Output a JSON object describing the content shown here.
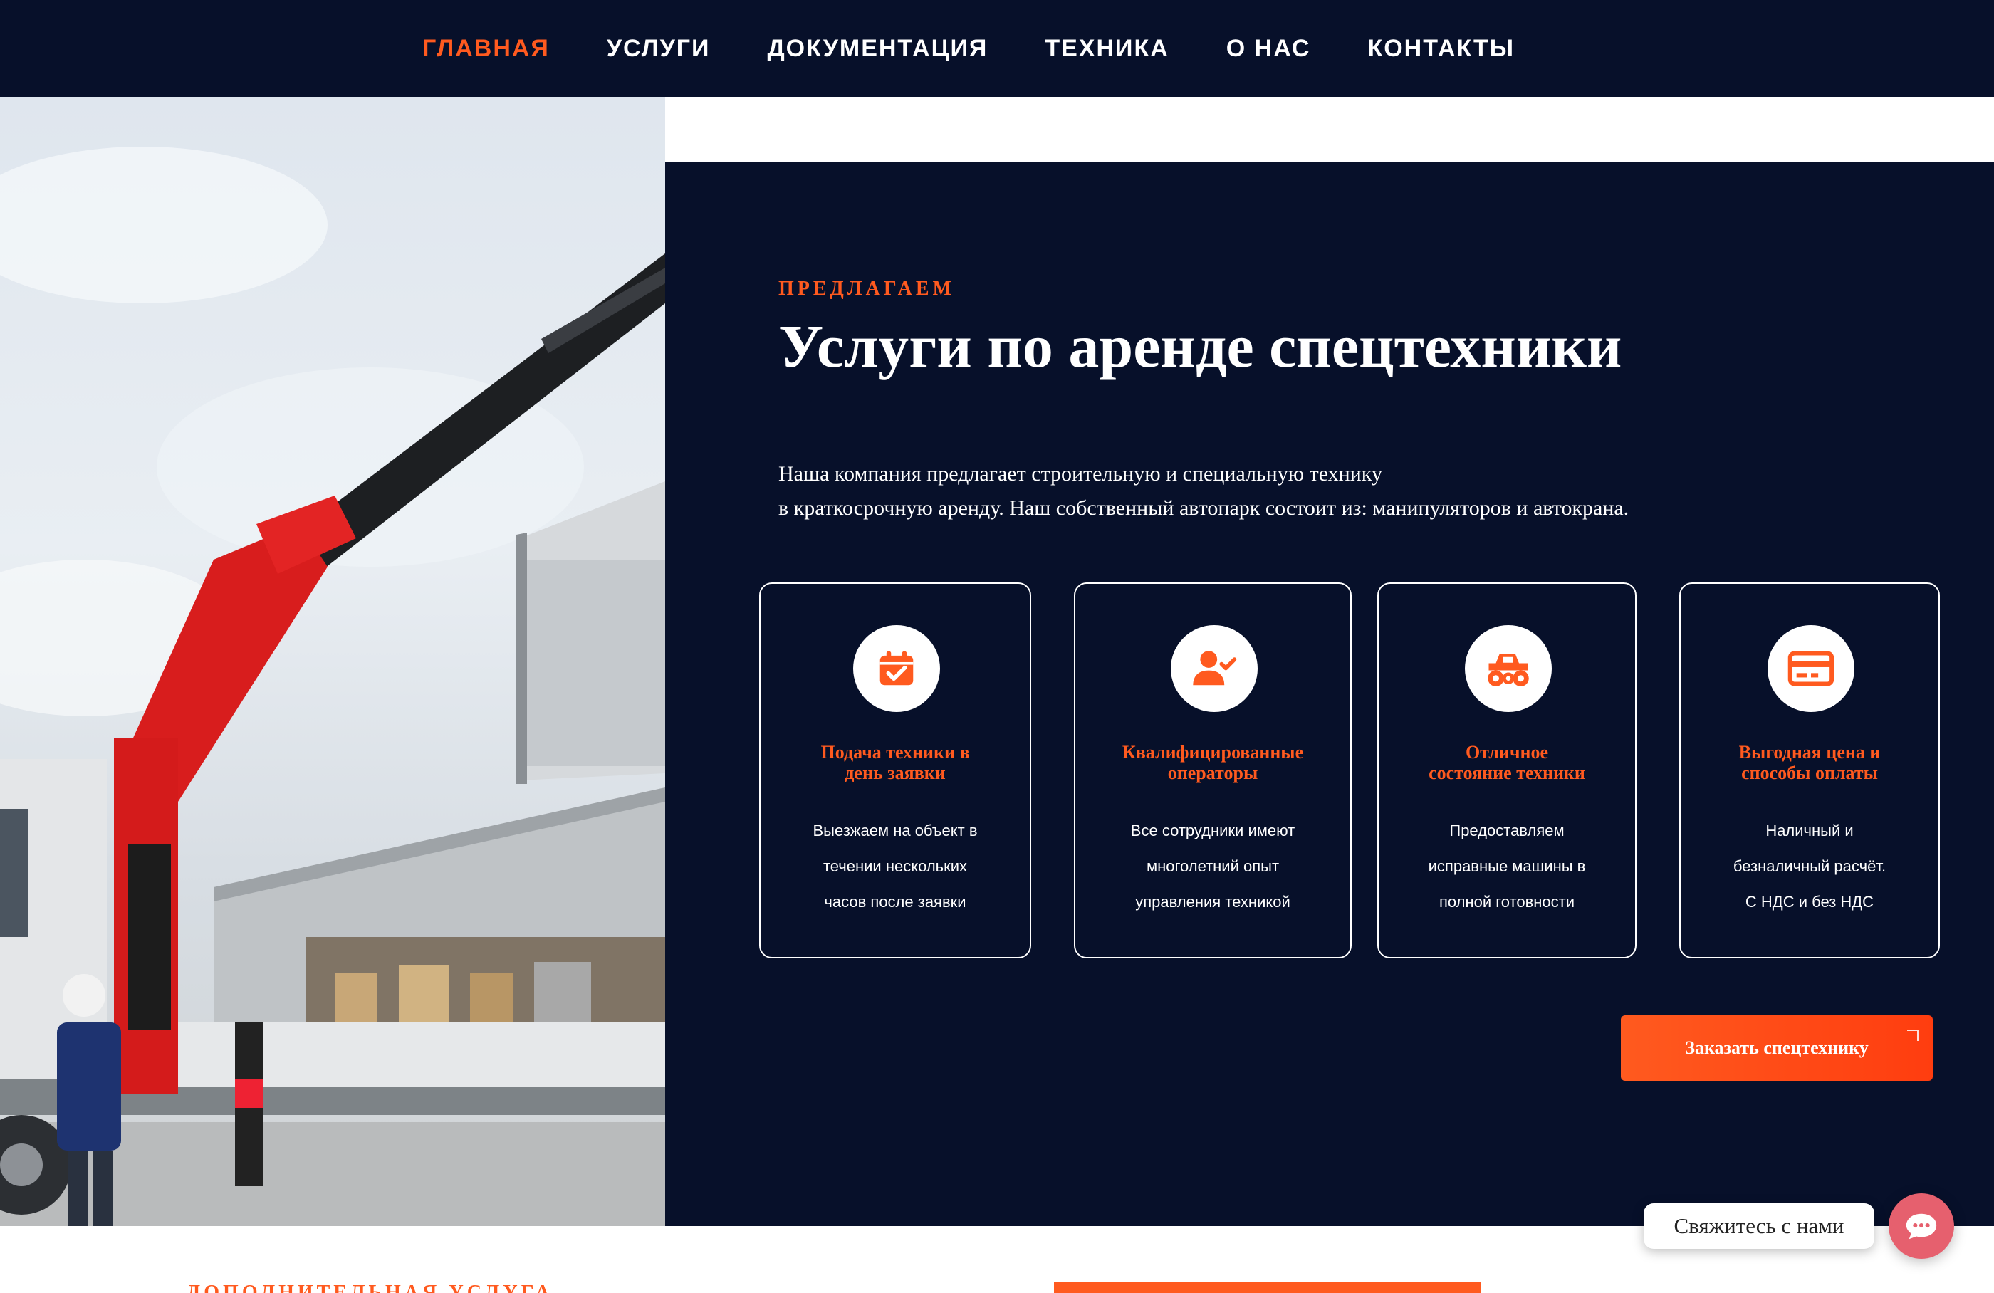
{
  "nav": {
    "items": [
      {
        "label": "ГЛАВНАЯ",
        "active": true
      },
      {
        "label": "УСЛУГИ",
        "active": false
      },
      {
        "label": "ДОКУМЕНТАЦИЯ",
        "active": false
      },
      {
        "label": "ТЕХНИКА",
        "active": false
      },
      {
        "label": "О НАС",
        "active": false
      },
      {
        "label": "КОНТАКТЫ",
        "active": false
      }
    ]
  },
  "hero": {
    "eyebrow": "ПРЕДЛАГАЕМ",
    "title": "Услуги по аренде спецтехники",
    "intro_line1": "Наша компания предлагает строительную и специальную технику",
    "intro_line2": "в краткосрочную аренду. Наш собственный автопарк состоит из: манипуляторов и автокрана."
  },
  "features": [
    {
      "icon": "calendar-check-icon",
      "title_line1": "Подача техники в",
      "title_line2": "день заявки",
      "text": [
        "Выезжаем на объект в",
        "течении нескольких",
        "часов после заявки"
      ]
    },
    {
      "icon": "user-check-icon",
      "title_line1": "Квалифицированные",
      "title_line2": "операторы",
      "text": [
        "Все сотрудники имеют",
        "многолетний опыт",
        "управления техникой"
      ]
    },
    {
      "icon": "truck-monster-icon",
      "title_line1": "Отличное",
      "title_line2": "состояние техники",
      "text": [
        "Предоставляем",
        "исправные машины в",
        "полной готовности"
      ]
    },
    {
      "icon": "credit-card-icon",
      "title_line1": "Выгодная цена и",
      "title_line2": "способы оплаты",
      "text": [
        "Наличный и",
        "безналичный расчёт.",
        "С НДС и без НДС"
      ]
    }
  ],
  "cta": {
    "label": "Заказать спецтехнику"
  },
  "chat": {
    "label": "Свяжитесь с нами",
    "icon": "chat-icon"
  },
  "bottom": {
    "eyebrow": "ДОПОЛНИТЕЛЬНАЯ УСЛУГА"
  },
  "colors": {
    "navy": "#07102a",
    "accent": "#ff5a1f",
    "chat": "#e6606e"
  }
}
